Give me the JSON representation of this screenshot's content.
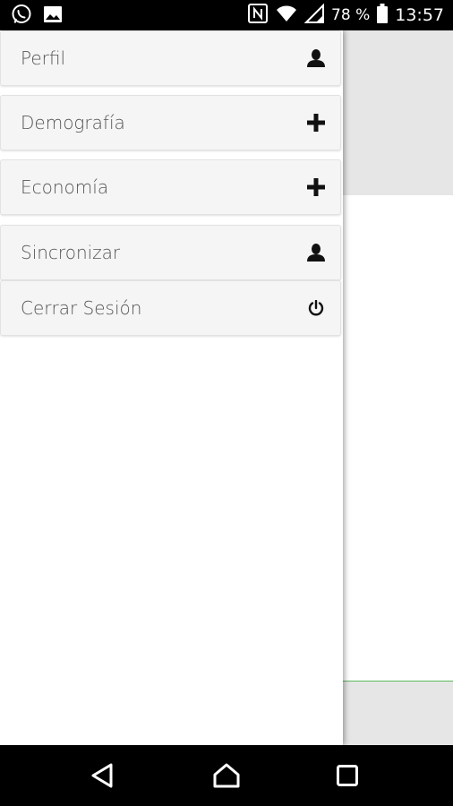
{
  "status_bar": {
    "battery": "78 %",
    "time": "13:57",
    "icons": [
      "whatsapp-icon",
      "image-icon",
      "nfc-icon",
      "wifi-icon",
      "signal-icon",
      "battery-icon"
    ]
  },
  "drawer": {
    "items": [
      {
        "label": "Perfil",
        "icon": "user-icon"
      },
      {
        "label": "Demografía",
        "icon": "plus-icon"
      },
      {
        "label": "Economía",
        "icon": "plus-icon"
      },
      {
        "label": "Sincronizar",
        "icon": "user-icon"
      },
      {
        "label": "Cerrar Sesión",
        "icon": "power-icon"
      }
    ]
  },
  "nav_bar": {
    "icons": [
      "back-icon",
      "home-icon",
      "recents-icon"
    ]
  },
  "colors": {
    "accent_line": "#5cb85c",
    "menu_bg": "#f5f5f5",
    "menu_text": "#555555"
  }
}
